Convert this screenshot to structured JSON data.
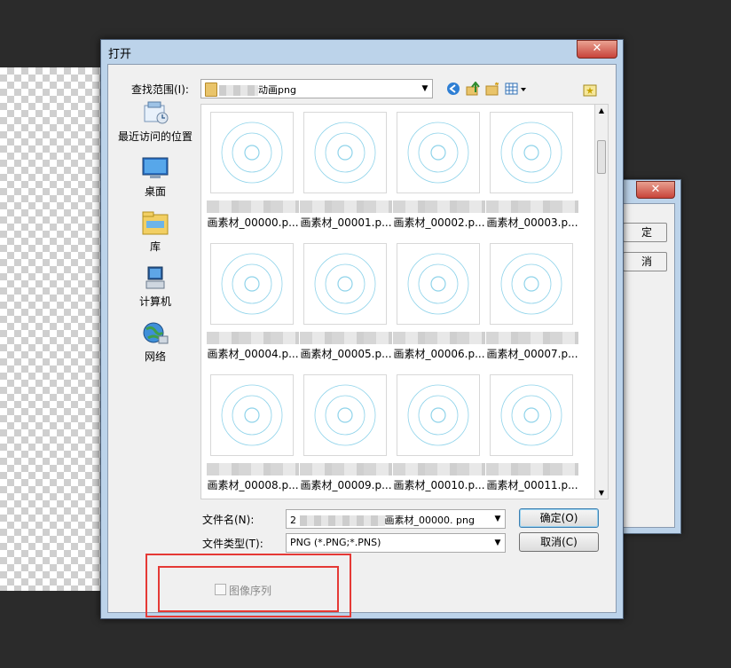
{
  "dialog": {
    "title": "打开",
    "close_glyph": "✕"
  },
  "look_in": {
    "label": "查找范围(I):",
    "value": "动画png"
  },
  "places": [
    {
      "label": "最近访问的位置",
      "icon": "recent-places-icon"
    },
    {
      "label": "桌面",
      "icon": "desktop-icon"
    },
    {
      "label": "库",
      "icon": "libraries-icon"
    },
    {
      "label": "计算机",
      "icon": "computer-icon"
    },
    {
      "label": "网络",
      "icon": "network-icon"
    }
  ],
  "files": [
    "画素材_00000.p...",
    "画素材_00001.p...",
    "画素材_00002.p...",
    "画素材_00003.p...",
    "画素材_00004.p...",
    "画素材_00005.p...",
    "画素材_00006.p...",
    "画素材_00007.p...",
    "画素材_00008.p...",
    "画素材_00009.p...",
    "画素材_00010.p...",
    "画素材_00011.p..."
  ],
  "filename": {
    "label": "文件名(N):",
    "value_prefix": "2",
    "value": "画素材_00000. png"
  },
  "filetype": {
    "label": "文件类型(T):",
    "value": "PNG (*.PNG;*.PNS)"
  },
  "buttons": {
    "ok": "确定(O)",
    "cancel": "取消(C)"
  },
  "image_sequence": {
    "label": "图像序列",
    "checked": false,
    "enabled": false
  },
  "bg_dialog": {
    "ok_partial": "定",
    "cancel_partial": "消",
    "close_glyph": "✕"
  },
  "colors": {
    "title_bar": "#bcd3ea",
    "close_red": "#c7423a",
    "highlight_box": "#e53935",
    "circle": "#8fd3ea"
  }
}
